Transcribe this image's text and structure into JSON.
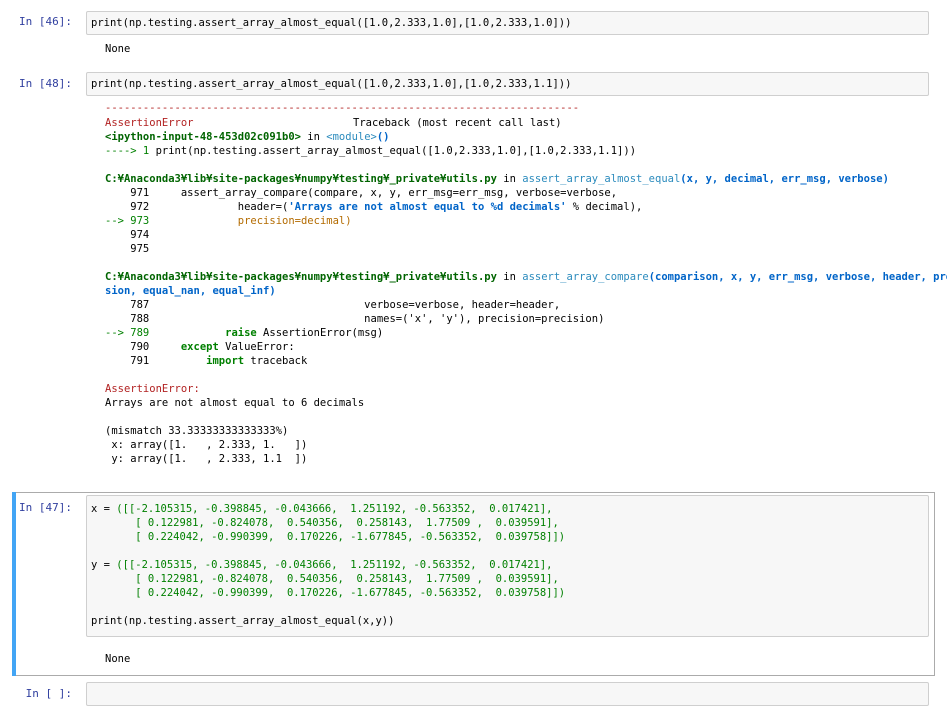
{
  "cells": {
    "c46": {
      "prompt": "In [46]:",
      "code": "print(np.testing.assert_array_almost_equal([1.0,2.333,1.0],[1.0,2.333,1.0]))",
      "output": "None"
    },
    "c48": {
      "prompt": "In [48]:",
      "code": "print(np.testing.assert_array_almost_equal([1.0,2.333,1.0],[1.0,2.333,1.1]))",
      "tb": {
        "rule": "---------------------------------------------------------------------------",
        "err_name": "AssertionError",
        "tb_header": "Traceback (most recent call last)",
        "input_ref": "<ipython-input-48-453d02c091b0>",
        "in_word": "in",
        "module": "<module>",
        "paren": "()",
        "arrow1": "----> 1 ",
        "arrow1_code": "print(np.testing.assert_array_almost_equal([1.0,2.333,1.0],[1.0,2.333,1.1]))",
        "path1": "C:¥Anaconda3¥lib¥site-packages¥numpy¥testing¥_private¥utils.py",
        "fn1": "assert_array_almost_equal",
        "args1": "(x, y, decimal, err_msg, verbose)",
        "l971": "    971     assert_array_compare(compare, x, y, err_msg=err_msg, verbose=verbose,",
        "l972a": "    972              header=(",
        "l972b": "'Arrays are not almost equal to %d decimals'",
        "l972c": " % decimal),",
        "l973a": "--> 973",
        "l973b": "              precision=decimal)",
        "l974": "    974",
        "l975": "    975",
        "path2": "C:¥Anaconda3¥lib¥site-packages¥numpy¥testing¥_private¥utils.py",
        "fn2": "assert_array_compare",
        "args2a": "(comparison, x, y, err_msg, verbose, header, preci",
        "args2b": "sion, equal_nan, equal_inf)",
        "l787": "    787                                  verbose=verbose, header=header,",
        "l788": "    788                                  names=('x', 'y'), precision=precision)",
        "l789a": "--> 789",
        "l789b": "            raise",
        "l789c": " AssertionError(msg)",
        "l790a": "    790     ",
        "l790b": "except",
        "l790c": " ValueError:",
        "l791a": "    791         ",
        "l791b": "import",
        "l791c": " traceback",
        "final_err": "AssertionError:",
        "msg1": "Arrays are not almost equal to 6 decimals",
        "msg2": "(mismatch 33.33333333333333%)",
        "msg3": " x: array([1.   , 2.333, 1.   ])",
        "msg4": " y: array([1.   , 2.333, 1.1  ])"
      }
    },
    "c47": {
      "prompt": "In [47]:",
      "x_name": "x",
      "eq": " = ",
      "rows_x": [
        "([[-2.105315, -0.398845, -0.043666,  1.251192, -0.563352,  0.017421],",
        "  [ 0.122981, -0.824078,  0.540356,  0.258143,  1.77509 ,  0.039591],",
        "  [ 0.224042, -0.990399,  0.170226, -1.677845, -0.563352,  0.039758]])"
      ],
      "y_name": "y",
      "rows_y": [
        "([[-2.105315, -0.398845, -0.043666,  1.251192, -0.563352,  0.017421],",
        "  [ 0.122981, -0.824078,  0.540356,  0.258143,  1.77509 ,  0.039591],",
        "  [ 0.224042, -0.990399,  0.170226, -1.677845, -0.563352,  0.039758]])"
      ],
      "print_line": "print(np.testing.assert_array_almost_equal(x,y))",
      "output": "None"
    },
    "cEmpty": {
      "prompt": "In [ ]:"
    }
  },
  "colors": {
    "prompt": "#303f9f",
    "selection_bar": "#42a5f5",
    "error_red": "#b22222"
  }
}
